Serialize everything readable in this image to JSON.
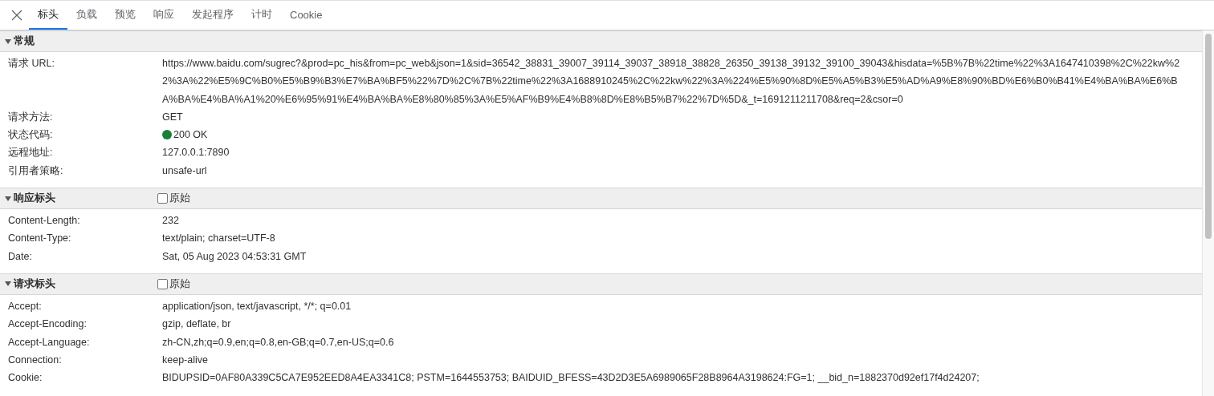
{
  "tabs": [
    {
      "label": "标头",
      "selected": true
    },
    {
      "label": "负载",
      "selected": false
    },
    {
      "label": "预览",
      "selected": false
    },
    {
      "label": "响应",
      "selected": false
    },
    {
      "label": "发起程序",
      "selected": false
    },
    {
      "label": "计时",
      "selected": false
    },
    {
      "label": "Cookie",
      "selected": false
    }
  ],
  "sections": [
    {
      "title": "常规",
      "expanded": true,
      "rows": [
        {
          "name": "请求 URL:",
          "value": "https://www.baidu.com/sugrec?&prod=pc_his&from=pc_web&json=1&sid=36542_38831_39007_39114_39037_38918_38828_26350_39138_39132_39100_39043&hisdata=%5B%7B%22time%22%3A1647410398%2C%22kw%22%3A%22%E5%9C%B0%E5%B9%B3%E7%BA%BF5%22%7D%2C%7B%22time%22%3A1688910245%2C%22kw%22%3A%224%E5%90%8D%E5%A5%B3%E5%AD%A9%E8%90%BD%E6%B0%B41%E4%BA%BA%E6%BA%BA%E4%BA%A1%20%E6%95%91%E4%BA%BA%E8%80%85%3A%E5%AF%B9%E4%B8%8D%E8%B5%B7%22%7D%5D&_t=1691211211708&req=2&csor=0"
        },
        {
          "name": "请求方法:",
          "value": "GET"
        },
        {
          "name": "状态代码:",
          "value": "200 OK",
          "color": "#188038"
        },
        {
          "name": "远程地址:",
          "value": "127.0.0.1:7890"
        },
        {
          "name": "引用者策略:",
          "value": "unsafe-url"
        }
      ]
    },
    {
      "title": "响应标头",
      "expanded": true,
      "raw": {
        "label": "原始",
        "checked": false
      },
      "rows": [
        {
          "name": "Content-Length:",
          "value": "232"
        },
        {
          "name": "Content-Type:",
          "value": "text/plain; charset=UTF-8"
        },
        {
          "name": "Date:",
          "value": "Sat, 05 Aug 2023 04:53:31 GMT"
        }
      ]
    },
    {
      "title": "请求标头",
      "expanded": true,
      "raw": {
        "label": "原始",
        "checked": false
      },
      "rows": [
        {
          "name": "Accept:",
          "value": "application/json, text/javascript, */*; q=0.01"
        },
        {
          "name": "Accept-Encoding:",
          "value": "gzip, deflate, br"
        },
        {
          "name": "Accept-Language:",
          "value": "zh-CN,zh;q=0.9,en;q=0.8,en-GB;q=0.7,en-US;q=0.6"
        },
        {
          "name": "Connection:",
          "value": "keep-alive"
        },
        {
          "name": "Cookie:",
          "value": "BIDUPSID=0AF80A339C5CA7E952EED8A4EA3341C8; PSTM=1644553753; BAIDUID_BFESS=43D2D3E5A6989065F28B8964A3198624:FG=1; __bid_n=1882370d92ef17f4d24207;"
        }
      ]
    }
  ]
}
